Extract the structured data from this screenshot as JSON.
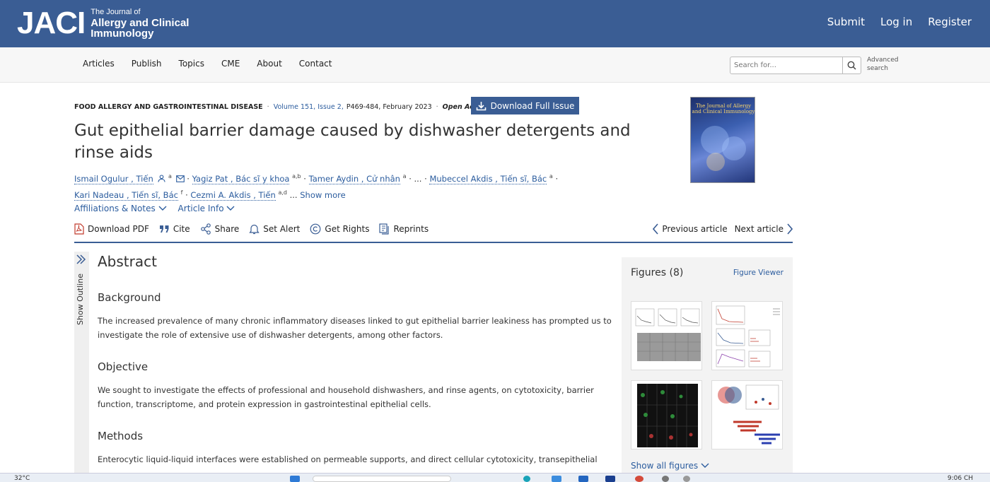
{
  "header": {
    "logo_mark": "JACI",
    "logo_line1": "The Journal of",
    "logo_line2": "Allergy and Clinical",
    "logo_line3": "Immunology",
    "links": [
      "Submit",
      "Log in",
      "Register"
    ]
  },
  "nav": {
    "items": [
      "Articles",
      "Publish",
      "Topics",
      "CME",
      "About",
      "Contact"
    ],
    "search_placeholder": "Search for...",
    "advanced_search": "Advanced search"
  },
  "article": {
    "section": "FOOD ALLERGY AND GASTROINTESTINAL DISEASE",
    "volume_issue": "Volume 151, Issue 2,",
    "pages_date": "P469-484, February 2023",
    "access": "Open Access",
    "download_issue": "Download Full Issue",
    "title": "Gut epithelial barrier damage caused by dishwasher detergents and rinse aids",
    "authors": [
      {
        "name": "Ismail Ogulur , Tiến",
        "sup": "a"
      },
      {
        "name": "Yagiz Pat , Bác sĩ y khoa",
        "sup": "a,b"
      },
      {
        "name": "Tamer Aydin , Cử nhân",
        "sup": "a"
      },
      {
        "name": "Mubeccel Akdis , Tiến sĩ, Bác",
        "sup": "a"
      },
      {
        "name": "Kari Nadeau , Tiến sĩ, Bác",
        "sup": "f"
      },
      {
        "name": "Cezmi A. Akdis , Tiến",
        "sup": "a,d"
      }
    ],
    "ellipsis": "...",
    "show_more": "Show more",
    "affiliations": "Affiliations & Notes",
    "article_info": "Article Info",
    "cover_text": "The Journal of Allergy and Clinical Immunology"
  },
  "toolbar": {
    "download_pdf": "Download PDF",
    "cite": "Cite",
    "share": "Share",
    "set_alert": "Set Alert",
    "get_rights": "Get Rights",
    "reprints": "Reprints",
    "previous": "Previous article",
    "next": "Next article"
  },
  "outline": {
    "label": "Show Outline"
  },
  "abstract": {
    "heading": "Abstract",
    "sections": [
      {
        "heading": "Background",
        "text": "The increased prevalence of many chronic inflammatory diseases linked to gut epithelial barrier leakiness has prompted us to investigate the role of extensive use of dishwasher detergents, among other factors."
      },
      {
        "heading": "Objective",
        "text": "We sought to investigate the effects of professional and household dishwashers, and rinse agents, on cytotoxicity, barrier function, transcriptome, and protein expression in gastrointestinal epithelial cells."
      },
      {
        "heading": "Methods",
        "text": "Enterocytic liquid-liquid interfaces were established on permeable supports, and direct cellular cytotoxicity, transepithelial"
      }
    ]
  },
  "figures": {
    "heading": "Figures (8)",
    "viewer": "Figure Viewer",
    "show_all": "Show all figures"
  },
  "taskbar": {
    "weather": "32°C",
    "clock": "9:06 CH"
  },
  "colors": {
    "brand": "#3a5d94",
    "link": "#2b5c9e"
  }
}
